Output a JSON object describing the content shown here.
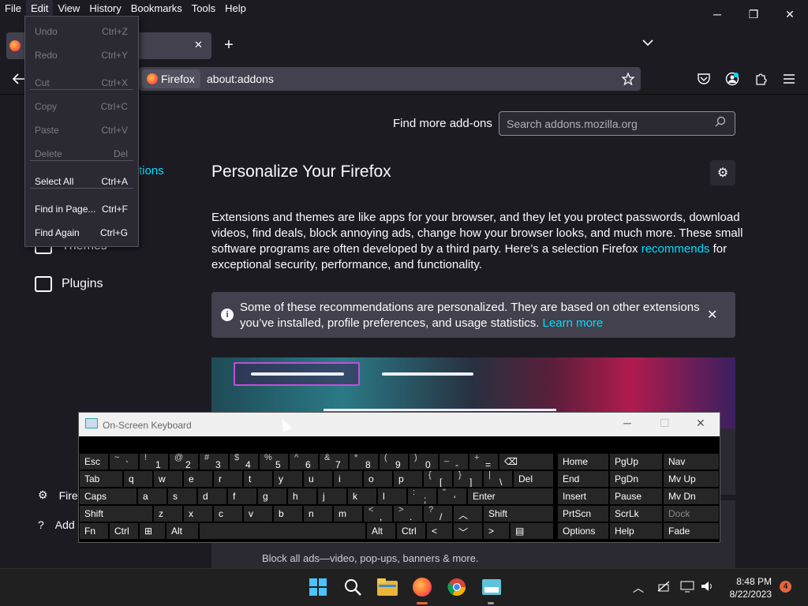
{
  "menubar": {
    "items": [
      "File",
      "Edit",
      "View",
      "History",
      "Bookmarks",
      "Tools",
      "Help"
    ]
  },
  "window": {
    "minimize": "─",
    "restore": "❐",
    "close": "✕"
  },
  "tabs": {
    "new_tab": "+",
    "list": "⌄",
    "close": "✕"
  },
  "urlbar": {
    "identity_label": "Firefox",
    "url": "about:addons"
  },
  "content": {
    "find_more_label": "Find more add-ons",
    "search_placeholder": "Search addons.mozilla.org",
    "heading": "Personalize Your Firefox",
    "para_1": "Extensions and themes are like apps for your browser, and they let you protect passwords, download videos, find deals, block annoying ads, change how your browser looks, and much more. These small software programs are often developed by a third party. Here’s a selection Firefox ",
    "para_link": "recommends",
    "para_2": " for exceptional security, performance, and functionality.",
    "notice_text": "Some of these recommendations are personalized. They are based on other extensions you’ve installed, profile preferences, and usage statistics. ",
    "notice_link": "Learn more",
    "block_ads": "Block all ads—video, pop-ups, banners & more."
  },
  "sidebar": {
    "partial_link": "tions",
    "themes": "Themes",
    "plugins": "Plugins",
    "firefox_settings": "Fire",
    "addons_support": "Add"
  },
  "edit_menu": {
    "items": [
      {
        "label": "Undo",
        "shortcut": "Ctrl+Z",
        "enabled": false
      },
      {
        "label": "Redo",
        "shortcut": "Ctrl+Y",
        "enabled": false
      },
      {
        "label": "Cut",
        "shortcut": "Ctrl+X",
        "enabled": false
      },
      {
        "label": "Copy",
        "shortcut": "Ctrl+C",
        "enabled": false
      },
      {
        "label": "Paste",
        "shortcut": "Ctrl+V",
        "enabled": false
      },
      {
        "label": "Delete",
        "shortcut": "Del",
        "enabled": false
      },
      {
        "label": "Select All",
        "shortcut": "Ctrl+A",
        "enabled": true
      },
      {
        "label": "Find in Page...",
        "shortcut": "Ctrl+F",
        "enabled": true
      },
      {
        "label": "Find Again",
        "shortcut": "Ctrl+G",
        "enabled": true
      }
    ]
  },
  "osk": {
    "title": "On-Screen Keyboard",
    "keys": {
      "esc": "Esc",
      "tab": "Tab",
      "caps": "Caps",
      "shift": "Shift",
      "fn": "Fn",
      "ctrl": "Ctrl",
      "alt": "Alt",
      "del": "Del",
      "enter": "Enter",
      "shift_r": "Shift",
      "alt_r": "Alt",
      "ctrl_r": "Ctrl",
      "home": "Home",
      "pgup": "PgUp",
      "nav": "Nav",
      "end": "End",
      "pgdn": "PgDn",
      "mvup": "Mv Up",
      "insert": "Insert",
      "pause": "Pause",
      "mvdn": "Mv Dn",
      "prtscn": "PrtScn",
      "scrlk": "ScrLk",
      "dock": "Dock",
      "options": "Options",
      "help": "Help",
      "fade": "Fade",
      "row1": [
        [
          "~",
          "`"
        ],
        [
          "!",
          "1"
        ],
        [
          "@",
          "2"
        ],
        [
          "#",
          "3"
        ],
        [
          "$",
          "4"
        ],
        [
          "%",
          "5"
        ],
        [
          "^",
          "6"
        ],
        [
          "&",
          "7"
        ],
        [
          "*",
          "8"
        ],
        [
          "(",
          "9"
        ],
        [
          ")",
          "0"
        ],
        [
          "_",
          "-"
        ],
        [
          "+",
          "="
        ]
      ],
      "row2": [
        "q",
        "w",
        "e",
        "r",
        "t",
        "y",
        "u",
        "i",
        "o",
        "p"
      ],
      "row2_sym": [
        [
          "{",
          "["
        ],
        [
          "}",
          "]"
        ],
        [
          "|",
          "\\"
        ]
      ],
      "row3": [
        "a",
        "s",
        "d",
        "f",
        "g",
        "h",
        "j",
        "k",
        "l"
      ],
      "row3_sym": [
        [
          ":",
          ";"
        ],
        [
          "\"",
          "'"
        ]
      ],
      "row4": [
        "z",
        "x",
        "c",
        "v",
        "b",
        "n",
        "m"
      ],
      "row4_sym": [
        [
          "<",
          ","
        ],
        [
          ">",
          "."
        ],
        [
          "?",
          "/"
        ]
      ]
    }
  },
  "taskbar": {
    "time": "8:48 PM",
    "date": "8/22/2023",
    "notification_count": "4",
    "apps": [
      "start-icon",
      "search-icon",
      "file-explorer-icon",
      "firefox-icon",
      "chrome-icon",
      "osk-icon"
    ]
  }
}
